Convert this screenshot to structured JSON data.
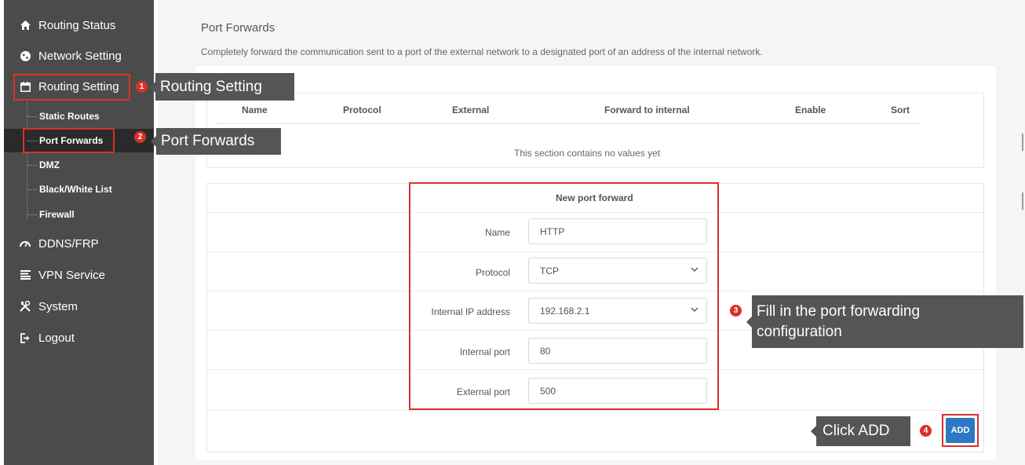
{
  "sidebar": {
    "items": [
      {
        "label": "Routing Status",
        "icon": "home-icon"
      },
      {
        "label": "Network Setting",
        "icon": "globe-icon"
      },
      {
        "label": "Routing Setting",
        "icon": "calendar-icon"
      },
      {
        "label": "DDNS/FRP",
        "icon": "speedometer-icon"
      },
      {
        "label": "VPN Service",
        "icon": "list-icon"
      },
      {
        "label": "System",
        "icon": "tools-icon"
      },
      {
        "label": "Logout",
        "icon": "logout-icon"
      }
    ],
    "sub_items": [
      {
        "label": "Static Routes"
      },
      {
        "label": "Port Forwards"
      },
      {
        "label": "DMZ"
      },
      {
        "label": "Black/White List"
      },
      {
        "label": "Firewall"
      }
    ]
  },
  "page": {
    "title": "Port Forwards",
    "description": "Completely forward the communication sent to a port of the external network to a designated port of an address of the internal network."
  },
  "table": {
    "columns": [
      "Name",
      "Protocol",
      "External",
      "Forward to internal",
      "Enable",
      "Sort"
    ],
    "empty_message": "This section contains no values yet"
  },
  "form": {
    "title": "New port forward",
    "fields": [
      {
        "label": "Name",
        "value": "HTTP",
        "type": "text"
      },
      {
        "label": "Protocol",
        "value": "TCP",
        "type": "select"
      },
      {
        "label": "Internal IP address",
        "value": "192.168.2.1",
        "type": "select"
      },
      {
        "label": "Internal port",
        "value": "80",
        "type": "text"
      },
      {
        "label": "External port",
        "value": "500",
        "type": "text"
      }
    ],
    "add_label": "ADD"
  },
  "annotations": [
    {
      "number": "1",
      "text": "Routing Setting"
    },
    {
      "number": "2",
      "text": "Port Forwards"
    },
    {
      "number": "3",
      "text_line1": "Fill in the port forwarding",
      "text_line2": "configuration"
    },
    {
      "number": "4",
      "text": "Click ADD"
    }
  ],
  "colors": {
    "sidebar_bg": "#4b4b4b",
    "active_bg": "#2a2a2a",
    "highlight_red": "#d9312b",
    "button_blue": "#2e78c4",
    "callout_bg": "#555555"
  }
}
